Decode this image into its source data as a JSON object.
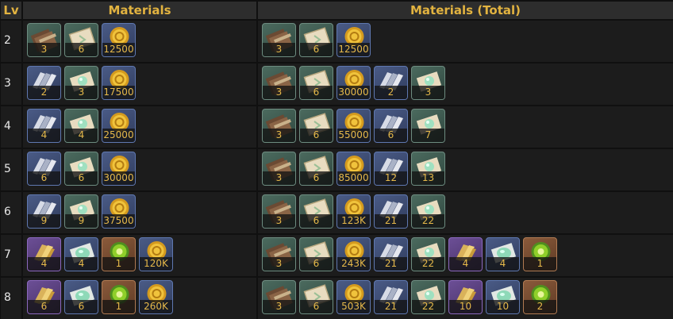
{
  "headers": {
    "lv": "Lv",
    "materials": "Materials",
    "materials_total": "Materials (Total)"
  },
  "rows": [
    {
      "lv": "2",
      "materials": [
        {
          "icon": "book-icon",
          "rarity": "green",
          "qty": "3"
        },
        {
          "icon": "scroll-icon",
          "rarity": "green",
          "qty": "6"
        },
        {
          "icon": "coin-icon",
          "rarity": "blue",
          "qty": "12500"
        }
      ],
      "total": [
        {
          "icon": "book-icon",
          "rarity": "green",
          "qty": "3"
        },
        {
          "icon": "scroll-icon",
          "rarity": "green",
          "qty": "6"
        },
        {
          "icon": "coin-icon",
          "rarity": "blue",
          "qty": "12500"
        }
      ]
    },
    {
      "lv": "3",
      "materials": [
        {
          "icon": "silver-book-icon",
          "rarity": "blue",
          "qty": "2"
        },
        {
          "icon": "crystal-scroll-icon",
          "rarity": "green",
          "qty": "3"
        },
        {
          "icon": "coin-icon",
          "rarity": "blue",
          "qty": "17500"
        }
      ],
      "total": [
        {
          "icon": "book-icon",
          "rarity": "green",
          "qty": "3"
        },
        {
          "icon": "scroll-icon",
          "rarity": "green",
          "qty": "6"
        },
        {
          "icon": "coin-icon",
          "rarity": "blue",
          "qty": "30000"
        },
        {
          "icon": "silver-book-icon",
          "rarity": "blue",
          "qty": "2"
        },
        {
          "icon": "crystal-scroll-icon",
          "rarity": "green",
          "qty": "3"
        }
      ]
    },
    {
      "lv": "4",
      "materials": [
        {
          "icon": "silver-book-icon",
          "rarity": "blue",
          "qty": "4"
        },
        {
          "icon": "crystal-scroll-icon",
          "rarity": "green",
          "qty": "4"
        },
        {
          "icon": "coin-icon",
          "rarity": "blue",
          "qty": "25000"
        }
      ],
      "total": [
        {
          "icon": "book-icon",
          "rarity": "green",
          "qty": "3"
        },
        {
          "icon": "scroll-icon",
          "rarity": "green",
          "qty": "6"
        },
        {
          "icon": "coin-icon",
          "rarity": "blue",
          "qty": "55000"
        },
        {
          "icon": "silver-book-icon",
          "rarity": "blue",
          "qty": "6"
        },
        {
          "icon": "crystal-scroll-icon",
          "rarity": "green",
          "qty": "7"
        }
      ]
    },
    {
      "lv": "5",
      "materials": [
        {
          "icon": "silver-book-icon",
          "rarity": "blue",
          "qty": "6"
        },
        {
          "icon": "crystal-scroll-icon",
          "rarity": "green",
          "qty": "6"
        },
        {
          "icon": "coin-icon",
          "rarity": "blue",
          "qty": "30000"
        }
      ],
      "total": [
        {
          "icon": "book-icon",
          "rarity": "green",
          "qty": "3"
        },
        {
          "icon": "scroll-icon",
          "rarity": "green",
          "qty": "6"
        },
        {
          "icon": "coin-icon",
          "rarity": "blue",
          "qty": "85000"
        },
        {
          "icon": "silver-book-icon",
          "rarity": "blue",
          "qty": "12"
        },
        {
          "icon": "crystal-scroll-icon",
          "rarity": "green",
          "qty": "13"
        }
      ]
    },
    {
      "lv": "6",
      "materials": [
        {
          "icon": "silver-book-icon",
          "rarity": "blue",
          "qty": "9"
        },
        {
          "icon": "crystal-scroll-icon",
          "rarity": "green",
          "qty": "9"
        },
        {
          "icon": "coin-icon",
          "rarity": "blue",
          "qty": "37500"
        }
      ],
      "total": [
        {
          "icon": "book-icon",
          "rarity": "green",
          "qty": "3"
        },
        {
          "icon": "scroll-icon",
          "rarity": "green",
          "qty": "6"
        },
        {
          "icon": "coin-icon",
          "rarity": "blue",
          "qty": "123K"
        },
        {
          "icon": "silver-book-icon",
          "rarity": "blue",
          "qty": "21"
        },
        {
          "icon": "crystal-scroll-icon",
          "rarity": "green",
          "qty": "22"
        }
      ]
    },
    {
      "lv": "7",
      "materials": [
        {
          "icon": "golden-book-icon",
          "rarity": "purple",
          "qty": "4"
        },
        {
          "icon": "jade-scroll-icon",
          "rarity": "blue",
          "qty": "4"
        },
        {
          "icon": "green-orb-icon",
          "rarity": "orange",
          "qty": "1"
        },
        {
          "icon": "coin-icon",
          "rarity": "blue",
          "qty": "120K"
        }
      ],
      "total": [
        {
          "icon": "book-icon",
          "rarity": "green",
          "qty": "3"
        },
        {
          "icon": "scroll-icon",
          "rarity": "green",
          "qty": "6"
        },
        {
          "icon": "coin-icon",
          "rarity": "blue",
          "qty": "243K"
        },
        {
          "icon": "silver-book-icon",
          "rarity": "blue",
          "qty": "21"
        },
        {
          "icon": "crystal-scroll-icon",
          "rarity": "green",
          "qty": "22"
        },
        {
          "icon": "golden-book-icon",
          "rarity": "purple",
          "qty": "4"
        },
        {
          "icon": "jade-scroll-icon",
          "rarity": "blue",
          "qty": "4"
        },
        {
          "icon": "green-orb-icon",
          "rarity": "orange",
          "qty": "1"
        }
      ]
    },
    {
      "lv": "8",
      "materials": [
        {
          "icon": "golden-book-icon",
          "rarity": "purple",
          "qty": "6"
        },
        {
          "icon": "jade-scroll-icon",
          "rarity": "blue",
          "qty": "6"
        },
        {
          "icon": "green-orb-icon",
          "rarity": "orange",
          "qty": "1"
        },
        {
          "icon": "coin-icon",
          "rarity": "blue",
          "qty": "260K"
        }
      ],
      "total": [
        {
          "icon": "book-icon",
          "rarity": "green",
          "qty": "3"
        },
        {
          "icon": "scroll-icon",
          "rarity": "green",
          "qty": "6"
        },
        {
          "icon": "coin-icon",
          "rarity": "blue",
          "qty": "503K"
        },
        {
          "icon": "silver-book-icon",
          "rarity": "blue",
          "qty": "21"
        },
        {
          "icon": "crystal-scroll-icon",
          "rarity": "green",
          "qty": "22"
        },
        {
          "icon": "golden-book-icon",
          "rarity": "purple",
          "qty": "10"
        },
        {
          "icon": "jade-scroll-icon",
          "rarity": "blue",
          "qty": "10"
        },
        {
          "icon": "green-orb-icon",
          "rarity": "orange",
          "qty": "2"
        }
      ]
    }
  ]
}
